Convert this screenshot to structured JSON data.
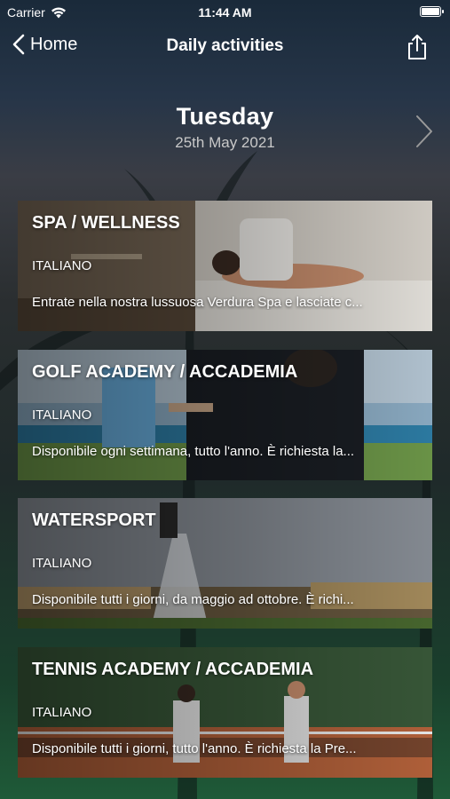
{
  "status_bar": {
    "carrier": "Carrier",
    "time": "11:44 AM"
  },
  "nav": {
    "back_label": "Home",
    "title": "Daily activities"
  },
  "day": {
    "name": "Tuesday",
    "date": "25th May 2021"
  },
  "activities": [
    {
      "title": "SPA / WELLNESS",
      "language": "ITALIANO",
      "description": "Entrate nella nostra lussuosa Verdura Spa e lasciate c..."
    },
    {
      "title": "GOLF ACADEMY / ACCADEMIA",
      "language": "ITALIANO",
      "description": "Disponibile ogni settimana, tutto l'anno. È richiesta la..."
    },
    {
      "title": "WATERSPORT",
      "language": "ITALIANO",
      "description": "Disponibile tutti i giorni, da maggio ad ottobre. È richi..."
    },
    {
      "title": "TENNIS ACADEMY / ACCADEMIA",
      "language": "ITALIANO",
      "description": "Disponibile tutti i giorni, tutto l'anno. È richiesta la Pre..."
    }
  ]
}
